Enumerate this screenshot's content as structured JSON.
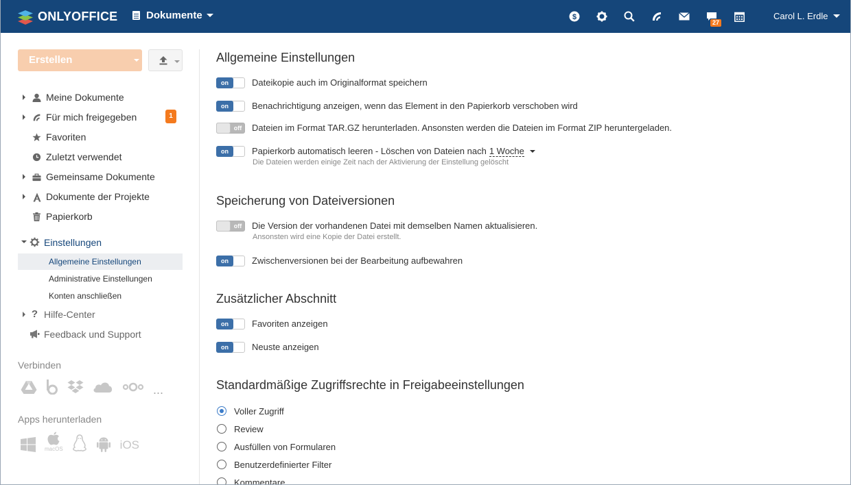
{
  "header": {
    "logo_text": "ONLYOFFICE",
    "module": "Dokumente",
    "chat_badge": "27",
    "user": "Carol L. Erdle",
    "icons": [
      "dollar-icon",
      "gear-icon",
      "search-icon",
      "feed-icon",
      "mail-icon",
      "chat-icon",
      "calendar-icon"
    ]
  },
  "sidebar": {
    "create_label": "Erstellen",
    "tree": [
      {
        "label": "Meine Dokumente",
        "icon": "user-icon",
        "expand": true
      },
      {
        "label": "Für mich freigegeben",
        "icon": "share-icon",
        "expand": true,
        "badge": "1"
      },
      {
        "label": "Favoriten",
        "icon": "star-icon",
        "expand": false
      },
      {
        "label": "Zuletzt verwendet",
        "icon": "clock-icon",
        "expand": false
      },
      {
        "label": "Gemeinsame Dokumente",
        "icon": "briefcase-icon",
        "expand": true
      },
      {
        "label": "Dokumente der Projekte",
        "icon": "projects-icon",
        "expand": true
      },
      {
        "label": "Papierkorb",
        "icon": "trash-icon",
        "expand": false
      }
    ],
    "settings_label": "Einstellungen",
    "settings_sub": [
      "Allgemeine Einstellungen",
      "Administrative Einstellungen",
      "Konten anschließen"
    ],
    "help_label": "Hilfe-Center",
    "feedback_label": "Feedback und Support",
    "connect_title": "Verbinden",
    "connect_more": "...",
    "apps_title": "Apps herunterladen",
    "macos_label": "macOS",
    "ios_label": "iOS"
  },
  "main": {
    "sections": {
      "general": "Allgemeine Einstellungen",
      "versions": "Speicherung von Dateiversionen",
      "additional": "Zusätzlicher Abschnitt",
      "access": "Standardmäßige Zugriffsrechte in Freigabeeinstellungen"
    },
    "toggle_on": "on",
    "toggle_off": "off",
    "options": {
      "o1": "Dateikopie auch im Originalformat speichern",
      "o2": "Benachrichtigung anzeigen, wenn das Element in den Papierkorb verschoben wird",
      "o3": "Dateien im Format TAR.GZ herunterladen. Ansonsten werden die Dateien im Format ZIP heruntergeladen.",
      "o4": "Papierkorb automatisch leeren - Löschen von Dateien nach",
      "o4_value": "1 Woche",
      "o4_hint": "Die Dateien werden einige Zeit nach der Aktivierung der Einstellung gelöscht",
      "o5": "Die Version der vorhandenen Datei mit demselben Namen aktualisieren.",
      "o5_hint": "Ansonsten wird eine Kopie der Datei erstellt.",
      "o6": "Zwischenversionen bei der Bearbeitung aufbewahren",
      "o7": "Favoriten anzeigen",
      "o8": "Neuste anzeigen"
    },
    "radios": [
      "Voller Zugriff",
      "Review",
      "Ausfüllen von Formularen",
      "Benutzerdefinierter Filter",
      "Kommentare"
    ],
    "radio_selected": 0
  }
}
